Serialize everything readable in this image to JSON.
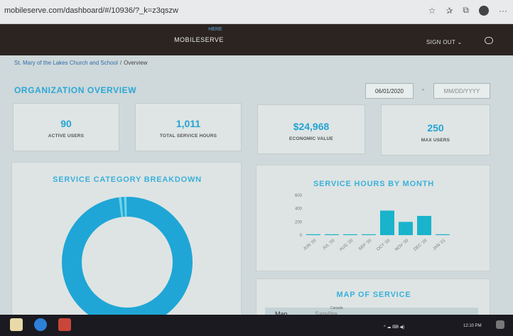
{
  "browser": {
    "url": "mobileserve.com/dashboard/#/10936/?_k=z3qszw",
    "icons": [
      "star-icon",
      "favorites-icon",
      "collections-icon",
      "profile-icon",
      "more-icon"
    ]
  },
  "header": {
    "brand": "MOBILESERVE",
    "sub_label": "HERE",
    "sign_out": "SIGN OUT",
    "chat_icon": "chat-icon"
  },
  "breadcrumb": {
    "org": "St. Mary of the Lakes Church and School",
    "separator": "/",
    "current": "Overview"
  },
  "overview": {
    "title": "ORGANIZATION OVERVIEW",
    "date_start": "06/01/2020",
    "date_separator": "-",
    "date_end_placeholder": "MM/DD/YYYY"
  },
  "stats": [
    {
      "value": "90",
      "label": "ACTIVE USERS"
    },
    {
      "value": "1,011",
      "label": "TOTAL SERVICE HOURS"
    },
    {
      "value": "$24,968",
      "label": "ECONOMIC VALUE"
    },
    {
      "value": "250",
      "label": "MAX USERS"
    }
  ],
  "category_breakdown": {
    "title": "SERVICE CATEGORY BREAKDOWN",
    "primary_color": "#1fa6d6",
    "secondary_color": "#6fd3ea"
  },
  "service_by_month": {
    "title": "SERVICE HOURS BY MONTH"
  },
  "chart_data": {
    "type": "bar",
    "title": "SERVICE HOURS BY MONTH",
    "categories": [
      "JUN '20",
      "JUL '20",
      "AUG '20",
      "SEP '20",
      "OCT '20",
      "NOV '20",
      "DEC '20",
      "JAN '21"
    ],
    "values": [
      4,
      5,
      4,
      12,
      370,
      200,
      290,
      5
    ],
    "ylim": [
      0,
      600
    ],
    "yticks": [
      "600",
      "400",
      "200",
      "0"
    ],
    "color": "#19b3cc",
    "grid": false
  },
  "map": {
    "title": "MAP OF SERVICE",
    "map_tab": "Map",
    "satellite_tab": "Satellite",
    "label_canada": "Canada"
  },
  "taskbar": {
    "time": "12:10 PM"
  }
}
